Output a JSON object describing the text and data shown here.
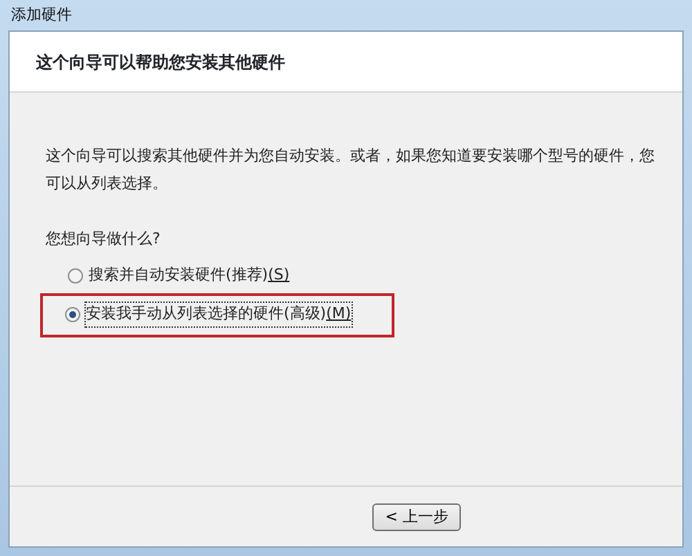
{
  "window": {
    "title": "添加硬件"
  },
  "header": {
    "heading": "这个向导可以帮助您安装其他硬件"
  },
  "body": {
    "description": "这个向导可以搜索其他硬件并为您自动安装。或者，如果您知道要安装哪个型号的硬件，您可以从列表选择。",
    "question": "您想向导做什么?"
  },
  "options": [
    {
      "label": "搜索并自动安装硬件(推荐)",
      "accesskey": "(S)",
      "selected": false,
      "highlighted": false
    },
    {
      "label": "安装我手动从列表选择的硬件(高级)",
      "accesskey": "(M)",
      "selected": true,
      "highlighted": true
    }
  ],
  "buttons": [
    {
      "label": "< 上一步"
    }
  ]
}
